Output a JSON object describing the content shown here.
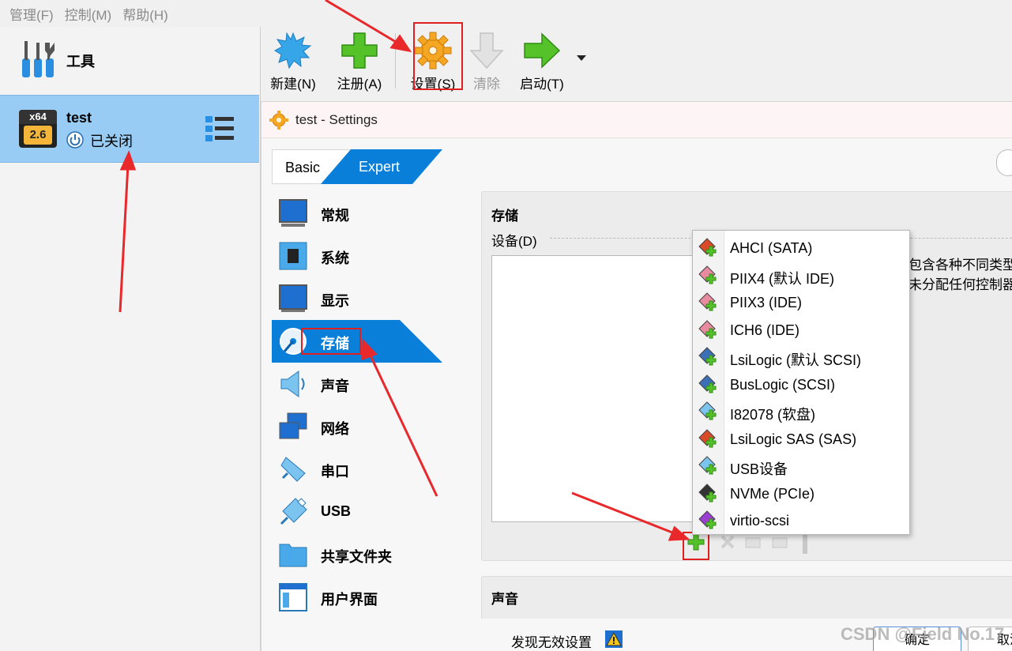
{
  "menubar": {
    "items": [
      "管理(F)",
      "控制(M)",
      "帮助(H)"
    ]
  },
  "leftpane": {
    "tools_label": "工具",
    "vm": {
      "name": "test",
      "state": "已关闭",
      "badge_arch": "x64",
      "badge_version": "2.6"
    }
  },
  "toolbar": {
    "new": "新建(N)",
    "register": "注册(A)",
    "settings": "设置(S)",
    "discard": "清除",
    "start": "启动(T)"
  },
  "dialog": {
    "title": "test - Settings",
    "mode_basic": "Basic",
    "mode_expert": "Expert",
    "categories": [
      {
        "label": "常规",
        "icon": "general-icon"
      },
      {
        "label": "系统",
        "icon": "system-icon"
      },
      {
        "label": "显示",
        "icon": "display-icon"
      },
      {
        "label": "存储",
        "icon": "storage-icon"
      },
      {
        "label": "声音",
        "icon": "audio-icon"
      },
      {
        "label": "网络",
        "icon": "network-icon"
      },
      {
        "label": "串口",
        "icon": "serial-port-icon"
      },
      {
        "label": "USB",
        "icon": "usb-icon"
      },
      {
        "label": "共享文件夹",
        "icon": "shared-folder-icon"
      },
      {
        "label": "用户界面",
        "icon": "user-interface-icon"
      }
    ],
    "storage": {
      "title": "存储",
      "devices_label": "设备(D)",
      "info_line1": "包含各种不同类型",
      "info_line2": "未分配任何控制器"
    },
    "audio": {
      "title": "声音"
    },
    "footer": {
      "warning": "发现无效设置",
      "ok": "确定",
      "cancel": "取消"
    }
  },
  "controller_menu": {
    "items": [
      "AHCI (SATA)",
      "PIIX4 (默认 IDE)",
      "PIIX3 (IDE)",
      "ICH6 (IDE)",
      "LsiLogic (默认 SCSI)",
      "BusLogic (SCSI)",
      "I82078 (软盘)",
      "LsiLogic SAS (SAS)",
      "USB设备",
      "NVMe (PCIe)",
      "virtio-scsi"
    ]
  },
  "watermark": "CSDN @Field No.17",
  "colors": {
    "accent": "#0a7fd9",
    "selection": "#99ccf5",
    "annotation": "#e02020"
  }
}
